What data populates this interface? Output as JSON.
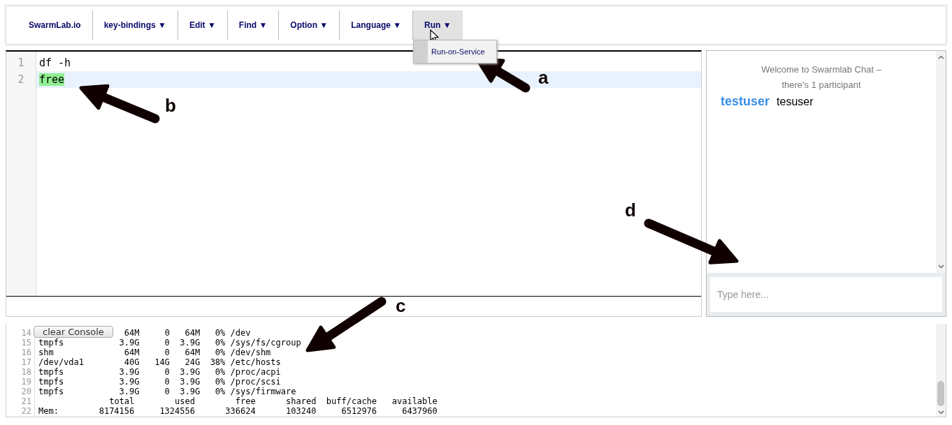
{
  "menu": {
    "items": [
      {
        "label": "SwarmLab.io",
        "selected": false
      },
      {
        "label": "key-bindings ▼",
        "selected": false
      },
      {
        "label": "Edit ▼",
        "selected": false
      },
      {
        "label": "Find ▼",
        "selected": false
      },
      {
        "label": "Option ▼",
        "selected": false
      },
      {
        "label": "Language ▼",
        "selected": false
      },
      {
        "label": "Run ▼",
        "selected": true
      }
    ],
    "dropdown": {
      "items": [
        "Run-on-Service"
      ]
    }
  },
  "editor": {
    "lines": [
      {
        "number": "1",
        "text": "df -h",
        "highlighted": false
      },
      {
        "number": "2",
        "text": "free",
        "highlighted": true
      }
    ]
  },
  "chat": {
    "welcome": "Welcome to Swarmlab Chat –",
    "participants_note": "there's 1 participant",
    "messages": [
      {
        "user": "testuser",
        "text": "tesuser"
      }
    ],
    "input": {
      "placeholder": "Type here..."
    }
  },
  "console": {
    "clear_button": "clear Console",
    "lines": [
      {
        "number": "14",
        "text": "                 64M     0   64M   0% /dev"
      },
      {
        "number": "15",
        "text": "tmpfs           3.9G     0  3.9G   0% /sys/fs/cgroup"
      },
      {
        "number": "16",
        "text": "shm              64M     0   64M   0% /dev/shm"
      },
      {
        "number": "17",
        "text": "/dev/vda1        40G   14G   24G  38% /etc/hosts"
      },
      {
        "number": "18",
        "text": "tmpfs           3.9G     0  3.9G   0% /proc/acpi"
      },
      {
        "number": "19",
        "text": "tmpfs           3.9G     0  3.9G   0% /proc/scsi"
      },
      {
        "number": "20",
        "text": "tmpfs           3.9G     0  3.9G   0% /sys/firmware"
      },
      {
        "number": "21",
        "text": "              total        used        free      shared  buff/cache   available"
      },
      {
        "number": "22",
        "text": "Mem:        8174156     1324556      336624      103240     6512976     6437960"
      }
    ]
  },
  "annotations": [
    {
      "label": "a"
    },
    {
      "label": "b"
    },
    {
      "label": "c"
    },
    {
      "label": "d"
    }
  ]
}
